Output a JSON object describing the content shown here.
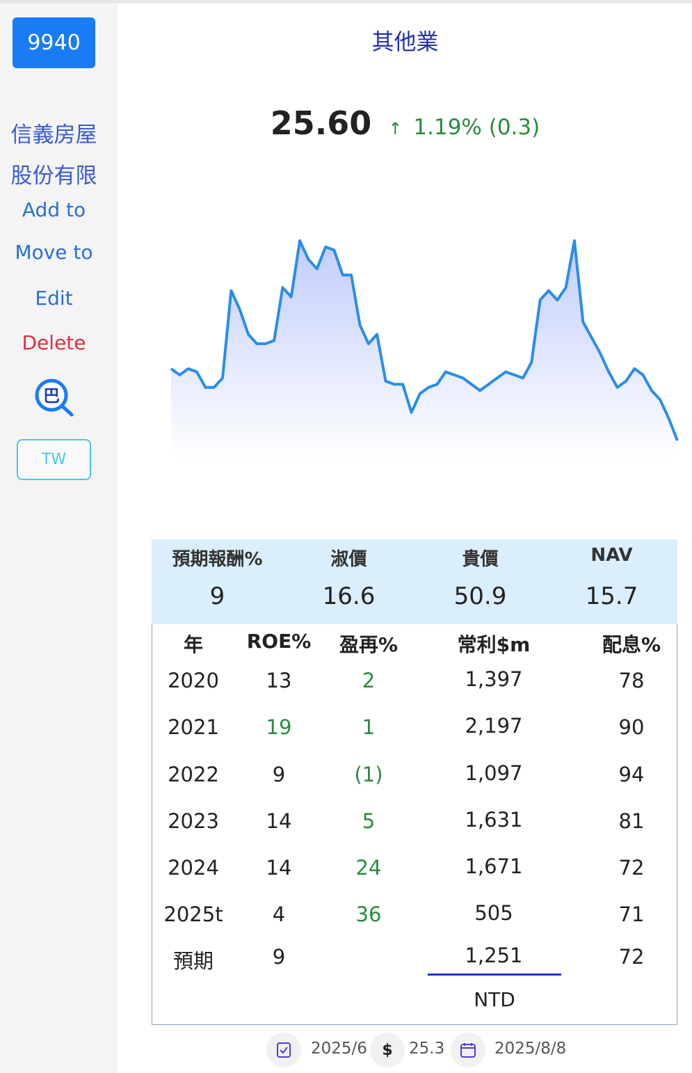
{
  "sidebar": {
    "ticker": "9940",
    "company_line1": "信義房屋",
    "company_line2": "股份有限",
    "add_to": "Add to",
    "move_to": "Move to",
    "edit": "Edit",
    "delete": "Delete",
    "search_glyph": "巴",
    "market_button": "TW"
  },
  "header": {
    "sector": "其他業",
    "price": "25.60",
    "arrow": "↑",
    "change": "1.19% (0.3)"
  },
  "colors": {
    "accent_blue": "#1a7cf5",
    "gain_green": "#2b8a3e",
    "delete_red": "#d8323c",
    "line_blue": "#2a8de6"
  },
  "chart_data": {
    "type": "area",
    "values": [
      30.1,
      29.9,
      30.1,
      30.0,
      29.5,
      29.5,
      29.8,
      32.6,
      32.0,
      31.2,
      30.9,
      30.9,
      31.0,
      32.7,
      32.4,
      34.2,
      33.6,
      33.3,
      34.0,
      33.9,
      33.1,
      33.1,
      31.5,
      30.9,
      31.2,
      29.7,
      29.6,
      29.6,
      28.7,
      29.3,
      29.5,
      29.6,
      30.0,
      29.9,
      29.8,
      29.6,
      29.4,
      29.6,
      29.8,
      30.0,
      29.9,
      29.8,
      30.3,
      32.3,
      32.6,
      32.3,
      32.7,
      34.2,
      31.6,
      31.1,
      30.6,
      30.0,
      29.5,
      29.7,
      30.1,
      29.9,
      29.4,
      29.1,
      28.5,
      27.8
    ],
    "ylim": [
      27.2,
      35.0
    ],
    "grid": false,
    "title": "",
    "xlabel": "",
    "ylabel": ""
  },
  "valuation": {
    "headers": [
      "預期報酬%",
      "淑價",
      "貴價",
      "NAV"
    ],
    "values": [
      "9",
      "16.6",
      "50.9",
      "15.7"
    ]
  },
  "table": {
    "headers": [
      "年",
      "ROE%",
      "盈再%",
      "常利$m",
      "配息%"
    ],
    "rows": [
      [
        "2020",
        "13",
        "2",
        "1,397",
        "78"
      ],
      [
        "2021",
        "19",
        "1",
        "2,197",
        "90"
      ],
      [
        "2022",
        "9",
        "(1)",
        "1,097",
        "94"
      ],
      [
        "2023",
        "14",
        "5",
        "1,631",
        "81"
      ],
      [
        "2024",
        "14",
        "24",
        "1,671",
        "72"
      ],
      [
        "2025t",
        "4",
        "36",
        "505",
        "71"
      ],
      [
        "預期",
        "9",
        "",
        "1,251",
        "72"
      ]
    ],
    "currency": "NTD"
  },
  "footer": {
    "report_period": "2025/6",
    "dollar_glyph": "$",
    "price": "25.3",
    "date": "2025/8/8"
  }
}
